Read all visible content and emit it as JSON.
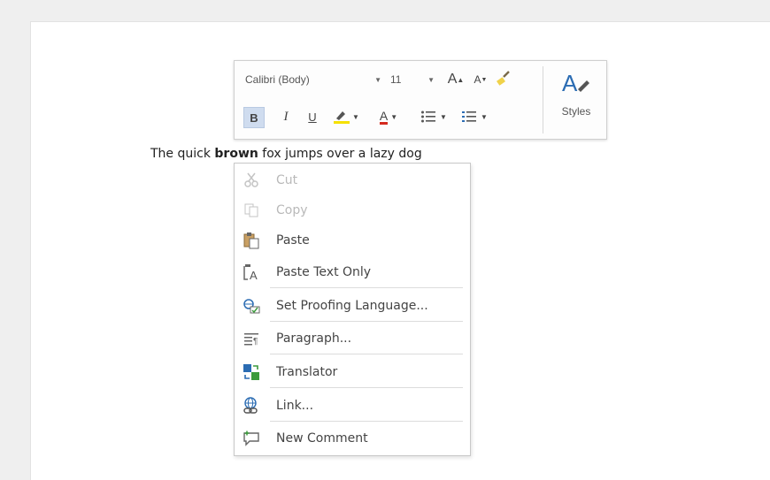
{
  "toolbar": {
    "font_name": "Calibri (Body)",
    "font_size": "11",
    "grow_font": "A",
    "shrink_font": "A",
    "bold": "B",
    "italic": "I",
    "underline": "U",
    "font_color": "A",
    "styles_label": "Styles"
  },
  "document": {
    "text_before": "The quick ",
    "text_bold": "brown",
    "text_after": " fox jumps over a lazy dog"
  },
  "context_menu": {
    "items": [
      {
        "label": "Cut",
        "icon": "scissors-icon",
        "enabled": false
      },
      {
        "label": "Copy",
        "icon": "copy-icon",
        "enabled": false
      },
      {
        "label": "Paste",
        "icon": "paste-icon",
        "enabled": true
      },
      {
        "label": "Paste Text Only",
        "icon": "paste-text-only-icon",
        "enabled": true
      },
      {
        "label": "Set Proofing Language...",
        "icon": "proofing-language-icon",
        "enabled": true
      },
      {
        "label": "Paragraph...",
        "icon": "paragraph-icon",
        "enabled": true
      },
      {
        "label": "Translator",
        "icon": "translator-icon",
        "enabled": true
      },
      {
        "label": "Link...",
        "icon": "link-icon",
        "enabled": true
      },
      {
        "label": "New Comment",
        "icon": "new-comment-icon",
        "enabled": true
      }
    ]
  },
  "colors": {
    "highlight_yellow": "#f5e100",
    "font_color_red": "#d42a1e",
    "accent_blue": "#2b6cb3",
    "selected_button": "#cfdcef"
  }
}
